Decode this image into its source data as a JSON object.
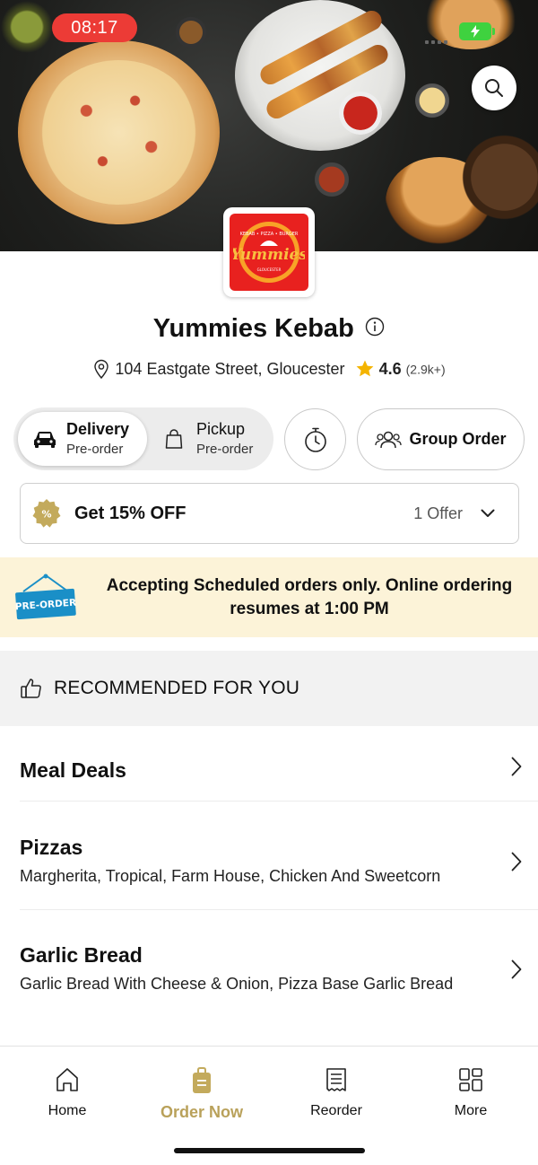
{
  "status_bar": {
    "time": "08:17"
  },
  "restaurant": {
    "name": "Yummies Kebab",
    "address": "104 Eastgate Street, Gloucester",
    "rating": "4.6",
    "rating_count": "(2.9k+)",
    "logo_text": "Yummies",
    "logo_tagline": "KEBAB • PIZZA • BURGER",
    "logo_subtext": "GLOUCESTER"
  },
  "order_type": {
    "delivery": {
      "label": "Delivery",
      "sub": "Pre-order",
      "selected": true
    },
    "pickup": {
      "label": "Pickup",
      "sub": "Pre-order",
      "selected": false
    },
    "group_order_label": "Group Order"
  },
  "offer": {
    "title": "Get 15% OFF",
    "count": "1 Offer"
  },
  "banner": {
    "sign_text": "PRE-ORDER",
    "message": "Accepting Scheduled orders only. Online ordering resumes at 1:00 PM"
  },
  "recommended": {
    "label": "RECOMMENDED FOR YOU"
  },
  "categories": [
    {
      "title": "Meal Deals",
      "subtitle": ""
    },
    {
      "title": "Pizzas",
      "subtitle": "Margherita, Tropical, Farm House, Chicken And Sweetcorn"
    },
    {
      "title": "Garlic Bread",
      "subtitle": "Garlic Bread With Cheese & Onion, Pizza Base Garlic Bread"
    }
  ],
  "tabs": [
    {
      "label": "Home",
      "icon": "home-icon",
      "active": false
    },
    {
      "label": "Order Now",
      "icon": "order-bag-icon",
      "active": true
    },
    {
      "label": "Reorder",
      "icon": "receipt-icon",
      "active": false
    },
    {
      "label": "More",
      "icon": "grid-icon",
      "active": false
    }
  ],
  "colors": {
    "accent_gold": "#b9a15a",
    "status_red": "#ec3b36",
    "banner_bg": "#fcf3d8",
    "battery_green": "#3fd23f",
    "logo_red": "#e8211f"
  }
}
